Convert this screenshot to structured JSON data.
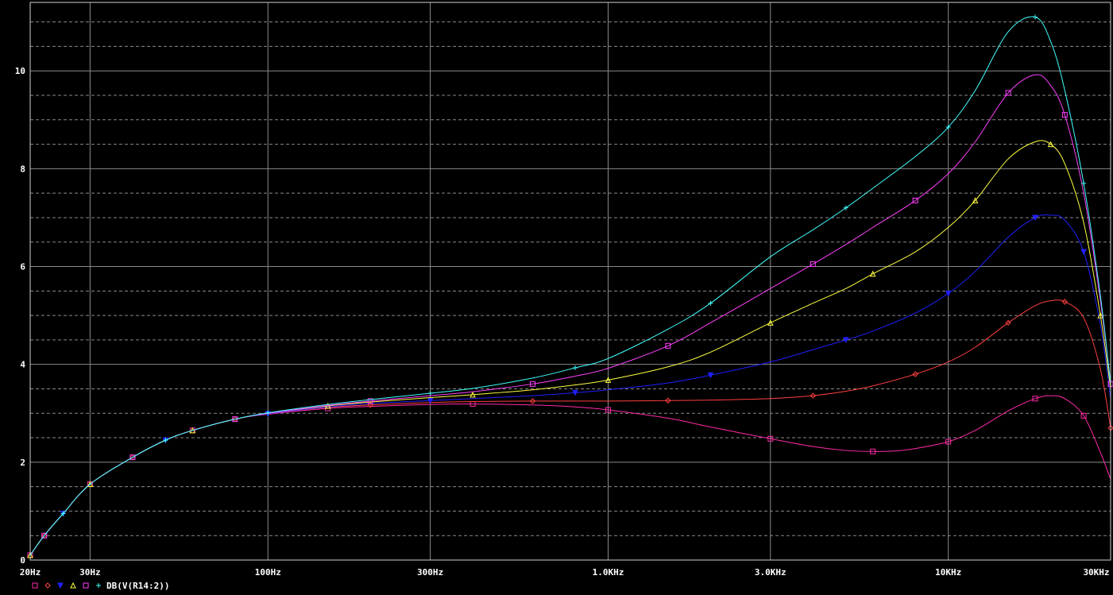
{
  "chart_data": {
    "type": "line",
    "x_scale": "log",
    "xlim": [
      20,
      30000
    ],
    "ylim": [
      0,
      11.4
    ],
    "grid": true,
    "x_ticks": [
      {
        "value": 20,
        "label": "20Hz"
      },
      {
        "value": 30,
        "label": "30Hz"
      },
      {
        "value": 100,
        "label": "100Hz"
      },
      {
        "value": 300,
        "label": "300Hz"
      },
      {
        "value": 1000,
        "label": "1.0KHz"
      },
      {
        "value": 3000,
        "label": "3.0KHz"
      },
      {
        "value": 10000,
        "label": "10KHz"
      },
      {
        "value": 30000,
        "label": "30KHz"
      }
    ],
    "y_ticks": [
      {
        "value": 0,
        "label": "0"
      },
      {
        "value": 2,
        "label": "2"
      },
      {
        "value": 4,
        "label": "4"
      },
      {
        "value": 6,
        "label": "6"
      },
      {
        "value": 8,
        "label": "8"
      },
      {
        "value": 10,
        "label": "10"
      }
    ],
    "legend": {
      "label": "DB(V(R14:2))",
      "placement": "bottom-left"
    },
    "series": [
      {
        "color": "#ff2aa8",
        "marker": "square",
        "x": [
          20,
          22,
          25,
          30,
          40,
          50,
          60,
          80,
          100,
          150,
          200,
          300,
          400,
          600,
          800,
          1000,
          1500,
          2000,
          3000,
          4000,
          5000,
          6000,
          7000,
          8000,
          10000,
          12000,
          15000,
          18000,
          20000,
          22000,
          25000,
          28000,
          30000
        ],
        "y": [
          0.1,
          0.5,
          0.95,
          1.55,
          2.1,
          2.45,
          2.65,
          2.88,
          2.98,
          3.1,
          3.14,
          3.18,
          3.19,
          3.17,
          3.13,
          3.07,
          2.9,
          2.72,
          2.48,
          2.32,
          2.24,
          2.22,
          2.23,
          2.28,
          2.42,
          2.65,
          3.05,
          3.3,
          3.36,
          3.3,
          2.95,
          2.2,
          1.65
        ]
      },
      {
        "color": "#ff4040",
        "marker": "diamond",
        "x": [
          20,
          22,
          25,
          30,
          40,
          50,
          60,
          80,
          100,
          150,
          200,
          300,
          400,
          600,
          800,
          1000,
          1500,
          2000,
          3000,
          4000,
          5000,
          6000,
          8000,
          10000,
          12000,
          15000,
          18000,
          20000,
          22000,
          25000,
          28000,
          30000
        ],
        "y": [
          0.1,
          0.5,
          0.95,
          1.55,
          2.1,
          2.45,
          2.65,
          2.88,
          2.99,
          3.12,
          3.17,
          3.22,
          3.24,
          3.25,
          3.25,
          3.25,
          3.26,
          3.27,
          3.3,
          3.36,
          3.45,
          3.56,
          3.8,
          4.05,
          4.35,
          4.85,
          5.2,
          5.3,
          5.28,
          4.95,
          3.9,
          2.7
        ]
      },
      {
        "color": "#2020ff",
        "marker": "triangle-down",
        "x": [
          20,
          22,
          25,
          30,
          40,
          50,
          60,
          80,
          100,
          150,
          200,
          300,
          400,
          600,
          800,
          1000,
          1500,
          2000,
          3000,
          4000,
          5000,
          6000,
          8000,
          10000,
          12000,
          15000,
          18000,
          20000,
          22000,
          25000,
          28000,
          30000
        ],
        "y": [
          0.1,
          0.5,
          0.95,
          1.55,
          2.1,
          2.45,
          2.65,
          2.88,
          2.99,
          3.13,
          3.2,
          3.26,
          3.3,
          3.36,
          3.42,
          3.48,
          3.62,
          3.78,
          4.05,
          4.3,
          4.5,
          4.68,
          5.05,
          5.45,
          5.9,
          6.6,
          7.0,
          7.05,
          6.95,
          6.3,
          4.8,
          3.3
        ]
      },
      {
        "color": "#ffff40",
        "marker": "triangle",
        "x": [
          20,
          22,
          25,
          30,
          40,
          50,
          60,
          80,
          100,
          150,
          200,
          300,
          400,
          600,
          800,
          1000,
          1500,
          2000,
          3000,
          4000,
          5000,
          6000,
          8000,
          10000,
          12000,
          15000,
          18000,
          20000,
          22000,
          25000,
          28000,
          30000
        ],
        "y": [
          0.1,
          0.5,
          0.95,
          1.55,
          2.1,
          2.45,
          2.65,
          2.88,
          3.0,
          3.15,
          3.23,
          3.32,
          3.38,
          3.48,
          3.58,
          3.68,
          3.95,
          4.25,
          4.85,
          5.25,
          5.55,
          5.85,
          6.3,
          6.8,
          7.35,
          8.2,
          8.55,
          8.5,
          8.1,
          6.9,
          5.0,
          3.5
        ]
      },
      {
        "color": "#ff40ff",
        "marker": "square",
        "x": [
          20,
          22,
          25,
          30,
          40,
          50,
          60,
          80,
          100,
          150,
          200,
          300,
          400,
          600,
          800,
          1000,
          1500,
          2000,
          3000,
          4000,
          5000,
          6000,
          8000,
          10000,
          12000,
          15000,
          18000,
          20000,
          22000,
          25000,
          28000,
          30000
        ],
        "y": [
          0.1,
          0.5,
          0.95,
          1.55,
          2.1,
          2.45,
          2.65,
          2.88,
          3.0,
          3.16,
          3.25,
          3.36,
          3.44,
          3.6,
          3.76,
          3.92,
          4.38,
          4.85,
          5.55,
          6.05,
          6.45,
          6.8,
          7.35,
          7.9,
          8.55,
          9.55,
          9.92,
          9.7,
          9.1,
          7.5,
          5.3,
          3.6
        ]
      },
      {
        "color": "#40ffff",
        "marker": "plus",
        "x": [
          20,
          22,
          25,
          30,
          40,
          50,
          60,
          80,
          100,
          150,
          200,
          300,
          400,
          600,
          800,
          1000,
          1500,
          2000,
          3000,
          4000,
          5000,
          6000,
          8000,
          10000,
          12000,
          15000,
          18000,
          20000,
          22000,
          25000,
          28000,
          30000
        ],
        "y": [
          0.1,
          0.5,
          0.95,
          1.55,
          2.1,
          2.45,
          2.65,
          2.88,
          3.01,
          3.18,
          3.28,
          3.41,
          3.51,
          3.72,
          3.93,
          4.12,
          4.72,
          5.25,
          6.2,
          6.75,
          7.2,
          7.6,
          8.25,
          8.85,
          9.6,
          10.8,
          11.1,
          10.6,
          9.6,
          7.7,
          5.4,
          3.6
        ]
      }
    ]
  }
}
